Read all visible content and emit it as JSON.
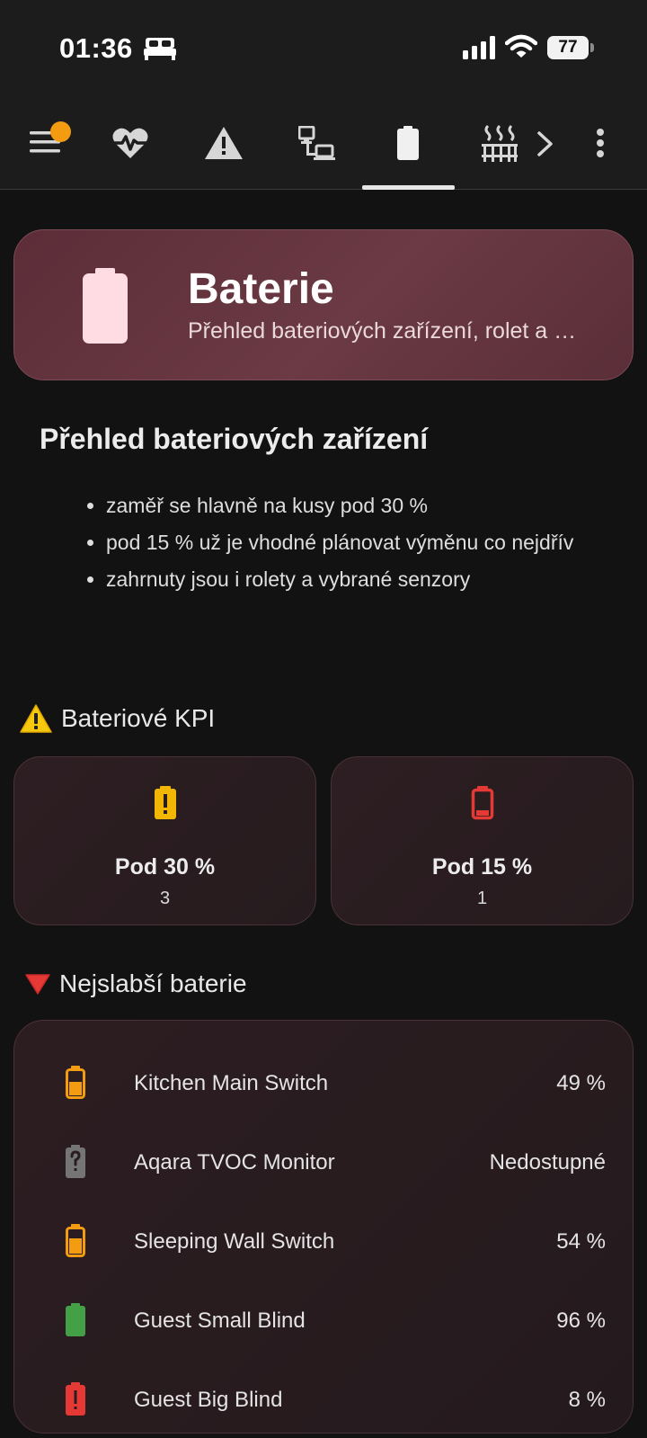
{
  "status_bar": {
    "time": "01:36",
    "battery_percent": "77"
  },
  "hero": {
    "title": "Baterie",
    "subtitle": "Přehled bateriových zařízení, rolet a …"
  },
  "intro": {
    "heading": "Přehled bateriových zařízení",
    "items": [
      "zaměř se hlavně na kusy pod 30 %",
      "pod 15 % už je vhodné plánovat výměnu co nejdřív",
      "zahrnuty jsou i rolety a vybrané senzory"
    ]
  },
  "kpi": {
    "title": "Bateriové KPI",
    "cards": [
      {
        "label": "Pod 30 %",
        "value": "3",
        "color": "#f2b705",
        "icon": "battery-alert-icon"
      },
      {
        "label": "Pod 15 %",
        "value": "1",
        "color": "#e53935",
        "icon": "battery-low-icon"
      }
    ]
  },
  "weakest": {
    "title": "Nejslabší baterie",
    "rows": [
      {
        "name": "Kitchen Main Switch",
        "value": "49 %",
        "color": "#f39c12",
        "level": 0.49
      },
      {
        "name": "Aqara TVOC Monitor",
        "value": "Nedostupné",
        "color": "#757575",
        "level": 0
      },
      {
        "name": "Sleeping Wall Switch",
        "value": "54 %",
        "color": "#f39c12",
        "level": 0.54
      },
      {
        "name": "Guest Small Blind",
        "value": "96 %",
        "color": "#43a047",
        "level": 0.96
      },
      {
        "name": "Guest Big Blind",
        "value": "8 %",
        "color": "#e53935",
        "level": 0.08
      }
    ]
  },
  "colors": {
    "accent_badge": "#f39c12",
    "hero_background": "#6b3a44"
  }
}
